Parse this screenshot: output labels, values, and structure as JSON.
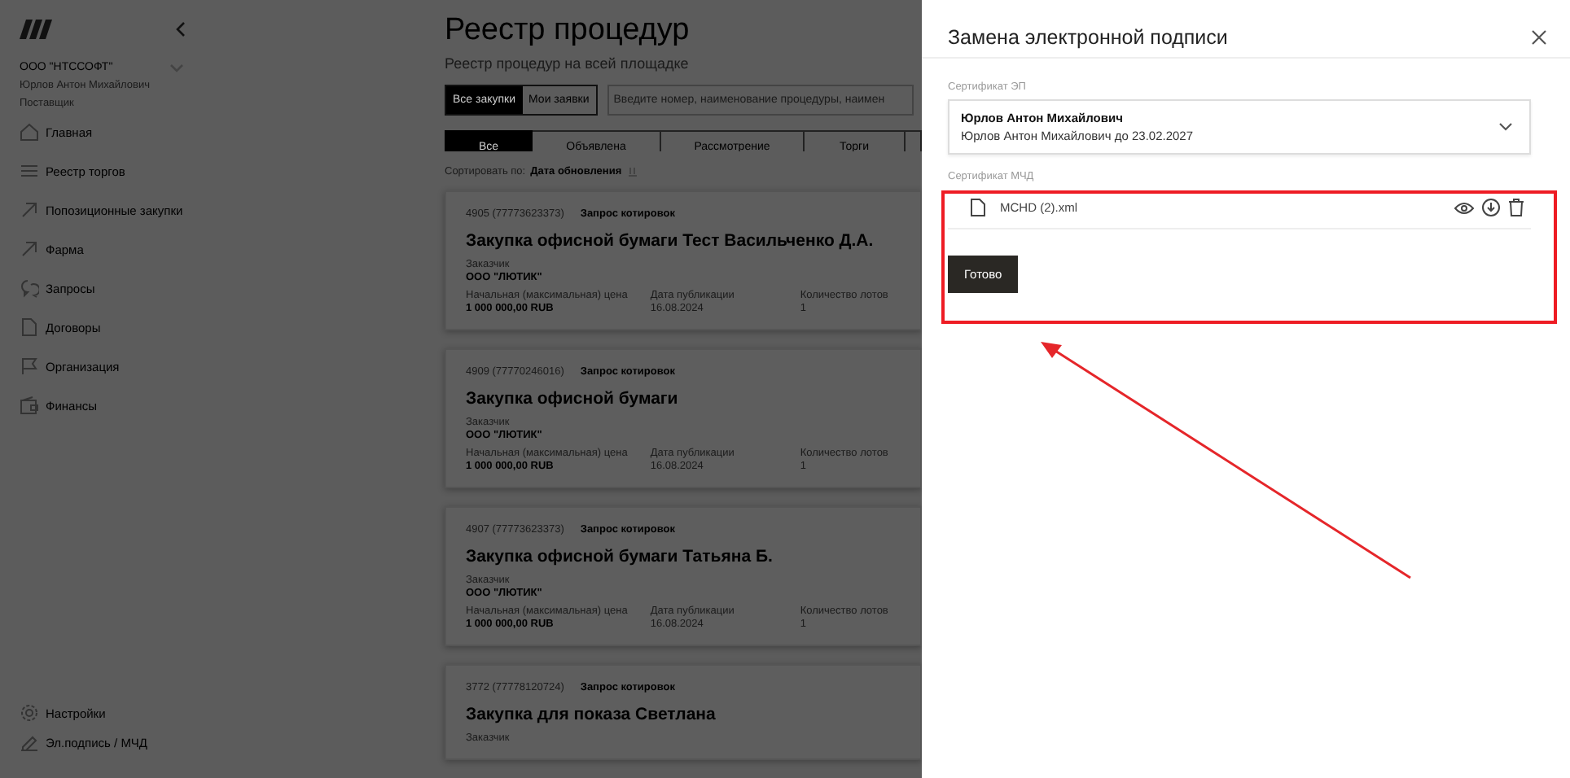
{
  "sidebar": {
    "org": "ООО \"НТССОФТ\"",
    "user": "Юрлов Антон Михайлович",
    "role": "Поставщик",
    "nav": [
      {
        "label": "Главная",
        "kind": "home"
      },
      {
        "label": "Реестр торгов",
        "kind": "list"
      },
      {
        "label": "Попозиционные закупки",
        "kind": "arrow"
      },
      {
        "label": "Фарма",
        "kind": "arrow"
      },
      {
        "label": "Запросы",
        "kind": "chat"
      },
      {
        "label": "Договоры",
        "kind": "doc"
      },
      {
        "label": "Организация",
        "kind": "flag"
      },
      {
        "label": "Финансы",
        "kind": "wallet"
      }
    ],
    "bottom": [
      {
        "label": "Настройки",
        "kind": "gear"
      },
      {
        "label": "Эл.подпись / МЧД",
        "kind": "pen"
      }
    ]
  },
  "page": {
    "title": "Реестр процедур",
    "subtitle": "Реестр процедур на всей площадке",
    "segments": [
      {
        "label": "Все закупки",
        "selected": true
      },
      {
        "label": "Мои заявки",
        "selected": false
      }
    ],
    "search": {
      "placeholder": "Введите номер, наименование процедуры, наимен"
    },
    "tabs": [
      {
        "label": "Все",
        "selected": true
      },
      {
        "label": "Объявлена",
        "selected": false
      },
      {
        "label": "Рассмотрение",
        "selected": false
      },
      {
        "label": "Торги",
        "selected": false
      }
    ],
    "sort_label": "Сортировать по:",
    "sort_value": "Дата обновления",
    "cards": [
      {
        "number": "4905 (77773623373)",
        "type": "Запрос котировок",
        "title": "Закупка офисной бумаги Тест Васильченко Д.А.",
        "customer_label": "Заказчик",
        "customer": "ООО \"ЛЮТИК\"",
        "fields": [
          {
            "label": "Начальная (максимальная) цена",
            "value": "1 000 000,00 RUB"
          },
          {
            "label": "Дата публикации",
            "value": "16.08.2024"
          },
          {
            "label": "Количество лотов",
            "value": "1"
          }
        ]
      },
      {
        "number": "4909 (77770246016)",
        "type": "Запрос котировок",
        "title": "Закупка офисной бумаги",
        "customer_label": "Заказчик",
        "customer": "ООО \"ЛЮТИК\"",
        "fields": [
          {
            "label": "Начальная (максимальная) цена",
            "value": "1 000 000,00 RUB"
          },
          {
            "label": "Дата публикации",
            "value": "16.08.2024"
          },
          {
            "label": "Количество лотов",
            "value": "1"
          }
        ]
      },
      {
        "number": "4907 (77773623373)",
        "type": "Запрос котировок",
        "title": "Закупка офисной бумаги Татьяна Б.",
        "customer_label": "Заказчик",
        "customer": "ООО \"ЛЮТИК\"",
        "fields": [
          {
            "label": "Начальная (максимальная) цена",
            "value": "1 000 000,00 RUB"
          },
          {
            "label": "Дата публикации",
            "value": "16.08.2024"
          },
          {
            "label": "Количество лотов",
            "value": "1"
          }
        ]
      },
      {
        "number": "3772 (77778120724)",
        "type": "Запрос котировок",
        "title": "Закупка для показа Светлана",
        "customer_label": "Заказчик"
      }
    ]
  },
  "drawer": {
    "title": "Замена электронной подписи",
    "cert_label": "Сертификат ЭП",
    "cert_name": "Юрлов Антон Михайлович",
    "cert_detail": "Юрлов Антон Михайлович до 23.02.2027",
    "mchd_label": "Сертификат МЧД",
    "file_name": "MCHD (2).xml",
    "done_button": "Готово"
  }
}
